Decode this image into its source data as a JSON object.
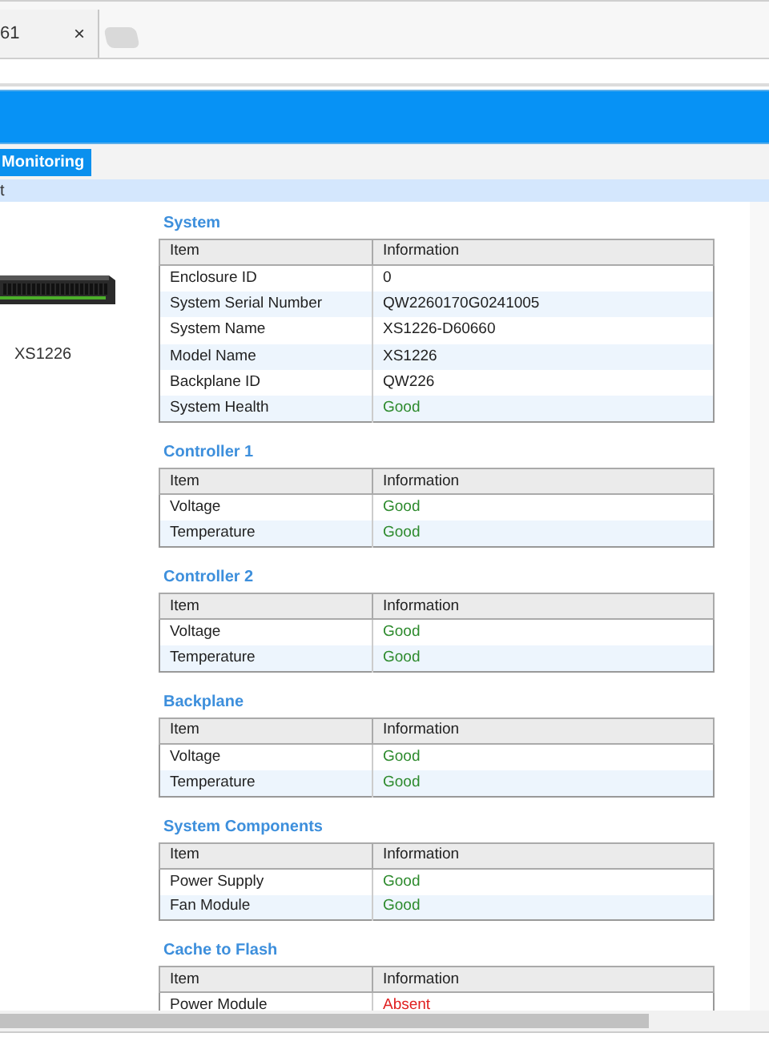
{
  "browser_tab": {
    "title": "61",
    "close": "×"
  },
  "nav": [
    {
      "label": "Monitoring",
      "selected": true
    }
  ],
  "breadcrumb": "t",
  "device": {
    "model": "XS1226"
  },
  "sections": [
    {
      "title": "System",
      "columns": [
        "Item",
        "Information"
      ],
      "rows": [
        {
          "item": "Enclosure ID",
          "info": "0"
        },
        {
          "item": "System Serial Number",
          "info": "QW2260170G0241005"
        },
        {
          "item": "System Name",
          "info": "XS1226-D60660"
        },
        {
          "item": "Model Name",
          "info": "XS1226"
        },
        {
          "item": "Backplane ID",
          "info": "QW226"
        },
        {
          "item": "System Health",
          "info": "Good",
          "kind": "good"
        }
      ]
    },
    {
      "title": "Controller 1",
      "columns": [
        "Item",
        "Information"
      ],
      "rows": [
        {
          "item": "Voltage",
          "info": "Good",
          "kind": "good"
        },
        {
          "item": "Temperature",
          "info": "Good",
          "kind": "good"
        }
      ]
    },
    {
      "title": "Controller 2",
      "columns": [
        "Item",
        "Information"
      ],
      "rows": [
        {
          "item": "Voltage",
          "info": "Good",
          "kind": "good"
        },
        {
          "item": "Temperature",
          "info": "Good",
          "kind": "good"
        }
      ]
    },
    {
      "title": "Backplane",
      "columns": [
        "Item",
        "Information"
      ],
      "rows": [
        {
          "item": "Voltage",
          "info": "Good",
          "kind": "good"
        },
        {
          "item": "Temperature",
          "info": "Good",
          "kind": "good"
        }
      ]
    },
    {
      "title": "System Components",
      "columns": [
        "Item",
        "Information"
      ],
      "rows": [
        {
          "item": "Power Supply",
          "info": "Good",
          "kind": "good"
        },
        {
          "item": "Fan Module",
          "info": "Good",
          "kind": "good"
        }
      ]
    },
    {
      "title": "Cache to Flash",
      "columns": [
        "Item",
        "Information"
      ],
      "rows": [
        {
          "item": "Power Module",
          "info": "Absent",
          "kind": "absent"
        }
      ]
    }
  ]
}
